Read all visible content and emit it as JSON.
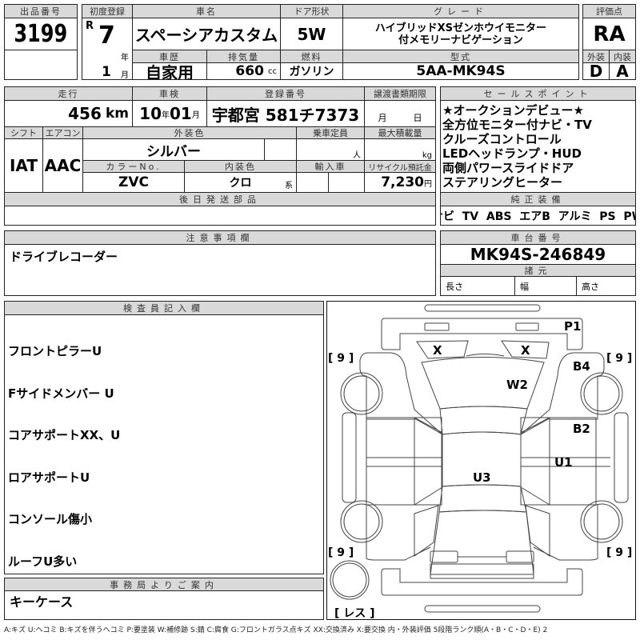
{
  "lot": {
    "label": "出品番号",
    "value": "3199"
  },
  "first_reg": {
    "label": "初度登録",
    "era": "R",
    "year": "7",
    "year_unit": "年",
    "month": "1",
    "month_unit": "月"
  },
  "car_name": {
    "label": "車名",
    "value": "スペーシアカスタム"
  },
  "door": {
    "label": "ドア形状",
    "value": "5W"
  },
  "grade": {
    "label": "グレード",
    "line1": "ハイブリッドXSゼンホウイモニター",
    "line2": "付メモリーナビゲーション"
  },
  "history": {
    "label": "車歴",
    "value": "自家用"
  },
  "displacement": {
    "label": "排気量",
    "value": "660",
    "unit": "cc"
  },
  "fuel": {
    "label": "燃料",
    "value": "ガソリン"
  },
  "model": {
    "label": "型式",
    "value": "5AA-MK94S"
  },
  "score": {
    "label": "評価点",
    "value": "RA",
    "exterior_label": "外装",
    "interior_label": "内装",
    "exterior": "D",
    "interior": "A"
  },
  "mileage": {
    "label": "走行",
    "value": "456",
    "unit": "km"
  },
  "inspection": {
    "label": "車検",
    "year": "10",
    "year_unit": "年",
    "month": "01",
    "month_unit": "月"
  },
  "registration": {
    "label": "登録番号",
    "value": "宇都宮 581チ7373"
  },
  "transfer_deadline": {
    "label": "譲渡書類期限",
    "month_unit": "月",
    "day_unit": "日"
  },
  "shift": {
    "label": "シフト",
    "value": "IAT"
  },
  "aircon": {
    "label": "エアコン",
    "value": "AAC"
  },
  "ext_color": {
    "label": "外装色",
    "value": "シルバー"
  },
  "capacity": {
    "label": "乗車定員",
    "unit": "人"
  },
  "max_load": {
    "label": "最大積載量",
    "unit": "kg"
  },
  "color_no": {
    "label": "カラーNo.",
    "value": "ZVC"
  },
  "int_color": {
    "label": "内装色",
    "value": "クロ",
    "suffix": "系"
  },
  "import": {
    "label": "輸入車"
  },
  "recycle": {
    "label": "リサイクル預託金",
    "value": "7,230",
    "unit": "円"
  },
  "later_parts": {
    "label": "後日発送部品"
  },
  "sales_points": {
    "label": "セールスポイント",
    "items": [
      "★オークションデビュー★",
      "全方位モニター付ナビ・TV",
      "クルーズコントロール",
      "LEDヘッドランプ・HUD",
      "両側パワースライドドア",
      "ステアリングヒーター"
    ]
  },
  "equipment": {
    "label": "純正装備",
    "value": "ナビ  TV  ABS  エアB  アルミ  PS  PW"
  },
  "notes": {
    "label": "注意事項欄",
    "value": "ドライブレコーダー"
  },
  "chassis": {
    "label": "車台番号",
    "value": "MK94S-246849",
    "spec_label": "諸元",
    "length": "長さ",
    "width": "幅",
    "height": "高さ"
  },
  "inspector": {
    "label": "検査員記入欄",
    "items": [
      "フロントピラーU",
      "Fサイドメンバー U",
      "コアサポートXX、U",
      "ロアサポートU",
      "コンソール傷小",
      "ルーフU多い"
    ]
  },
  "diagram": {
    "marks": {
      "p1": "P1",
      "x1": "X",
      "x2": "X",
      "b4": "B4",
      "w2": "W2",
      "b2": "B2",
      "u1": "U1",
      "u3": "U3"
    },
    "tire_fl": "[ 9 ]",
    "tire_fr": "[ 9 ]",
    "tire_rl": "[ 9 ]",
    "tire_rr": "[ 9 ]",
    "spare": "[ レス ]"
  },
  "office": {
    "label": "事務局よりご案内",
    "value": "キーケース"
  },
  "legend": "A:キズ U:ヘコミ B:キズを伴うヘコミ P:要塗装 W:補修跡 S:錆 C:腐食 G:フロントガラス点キズ XX:交換済み X:要交換  内・外装評価 5段階ランク順(A・B・C・D・E) 2"
}
